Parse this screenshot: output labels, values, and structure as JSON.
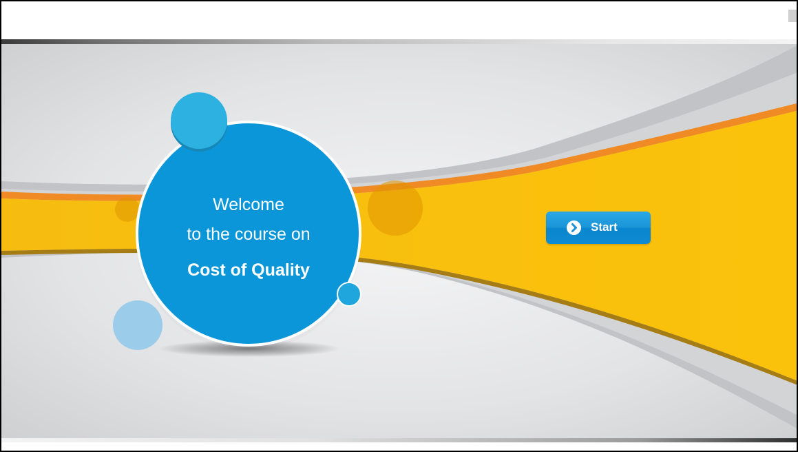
{
  "course": {
    "welcome": "Welcome",
    "intro": "to the course on",
    "title": "Cost of Quality"
  },
  "start_button": {
    "label": "Start",
    "icon": "chevron-right-circle-icon"
  },
  "colors": {
    "circle_blue": "#0a96d8",
    "band_yellow": "#f9c00e",
    "stripe_orange": "#f08a24",
    "button_blue": "#1b95d8",
    "background_gray": "#e4e5e7"
  }
}
